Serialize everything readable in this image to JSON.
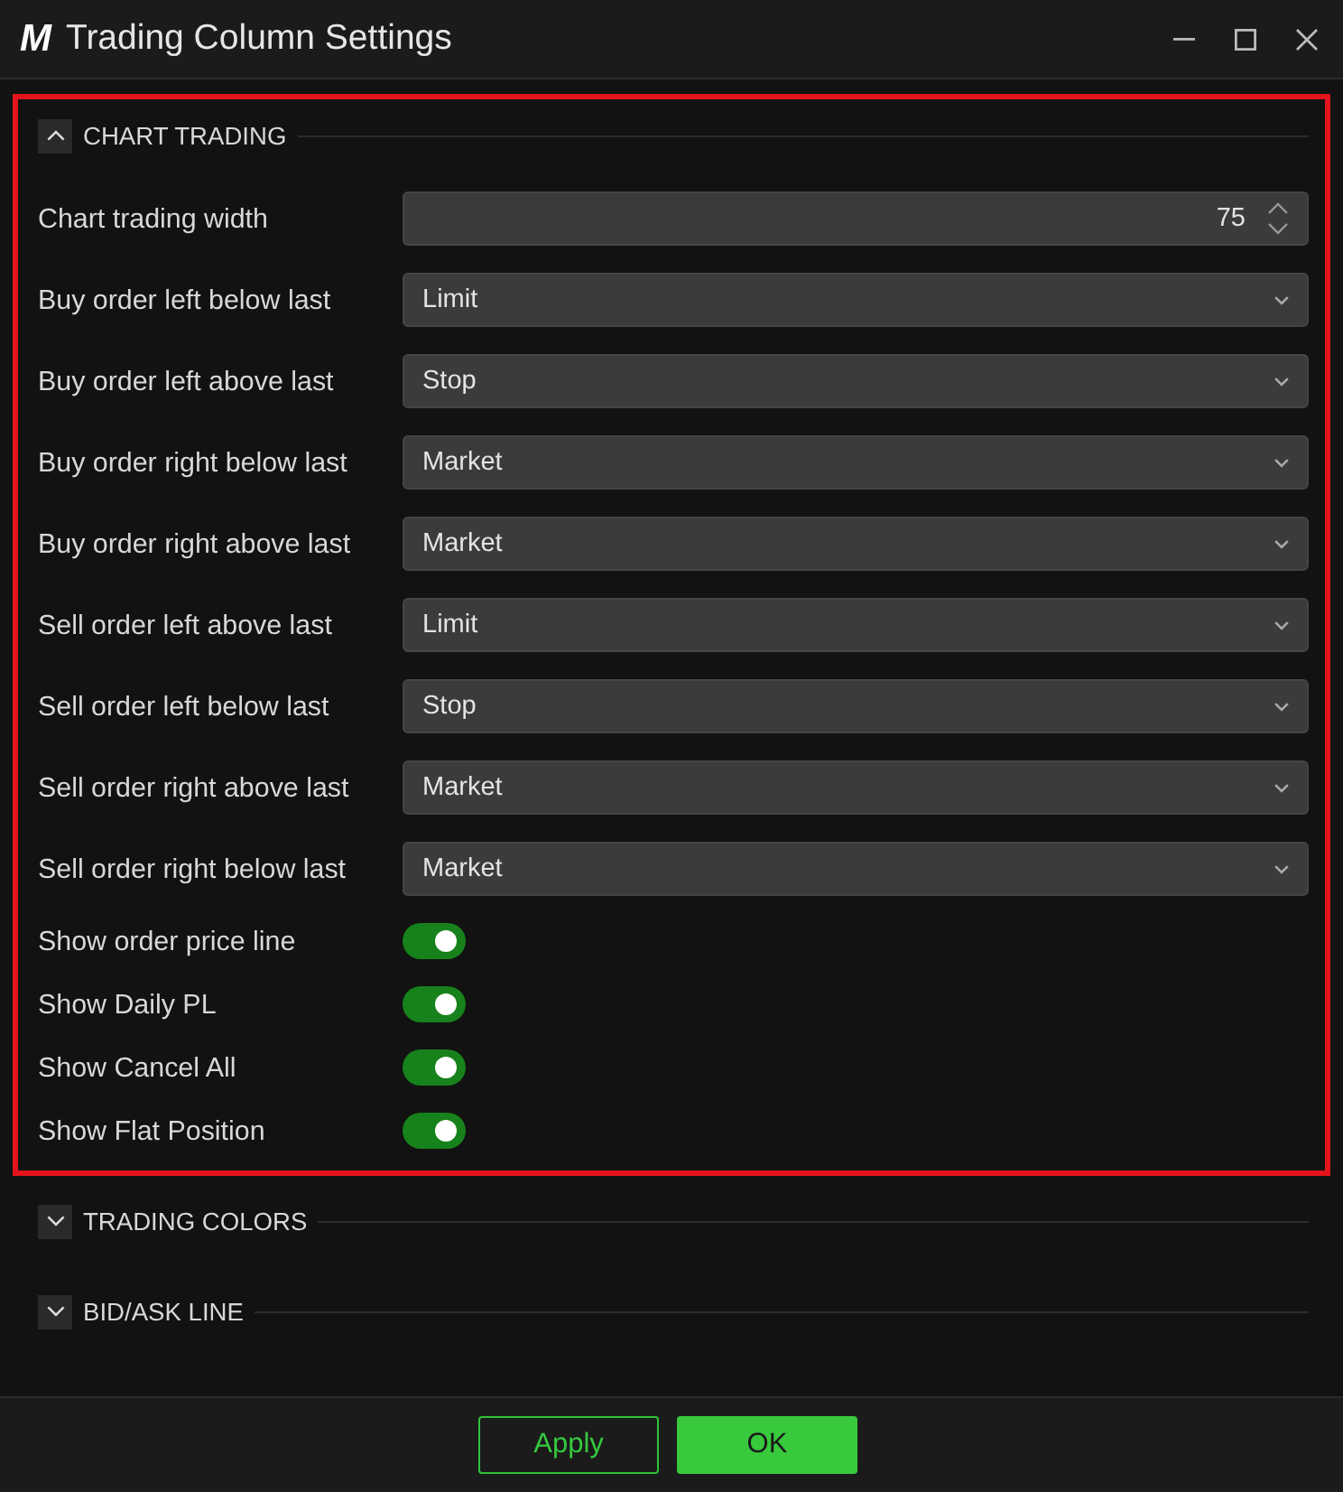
{
  "window": {
    "logo": "M",
    "title": "Trading Column Settings"
  },
  "sections": [
    {
      "title": "CHART TRADING",
      "expanded": true,
      "highlighted": true,
      "settings": [
        {
          "kind": "number",
          "label": "Chart trading width",
          "value": "75"
        },
        {
          "kind": "dropdown",
          "label": "Buy order left below last",
          "value": "Limit"
        },
        {
          "kind": "dropdown",
          "label": "Buy order left above last",
          "value": "Stop"
        },
        {
          "kind": "dropdown",
          "label": "Buy order right below last",
          "value": "Market"
        },
        {
          "kind": "dropdown",
          "label": "Buy order right above last",
          "value": "Market"
        },
        {
          "kind": "dropdown",
          "label": "Sell order left above last",
          "value": "Limit"
        },
        {
          "kind": "dropdown",
          "label": "Sell order left below last",
          "value": "Stop"
        },
        {
          "kind": "dropdown",
          "label": "Sell order right above last",
          "value": "Market"
        },
        {
          "kind": "dropdown",
          "label": "Sell order right below last",
          "value": "Market"
        },
        {
          "kind": "toggle",
          "label": "Show order price line",
          "on": true
        },
        {
          "kind": "toggle",
          "label": "Show Daily PL",
          "on": true
        },
        {
          "kind": "toggle",
          "label": "Show Cancel All",
          "on": true
        },
        {
          "kind": "toggle",
          "label": "Show Flat Position",
          "on": true
        }
      ]
    },
    {
      "title": "TRADING COLORS",
      "expanded": false,
      "highlighted": false
    },
    {
      "title": "BID/ASK LINE",
      "expanded": false,
      "highlighted": false
    }
  ],
  "buttons": [
    {
      "label": "Apply",
      "kind": "secondary"
    },
    {
      "label": "OK",
      "kind": "primary"
    }
  ]
}
